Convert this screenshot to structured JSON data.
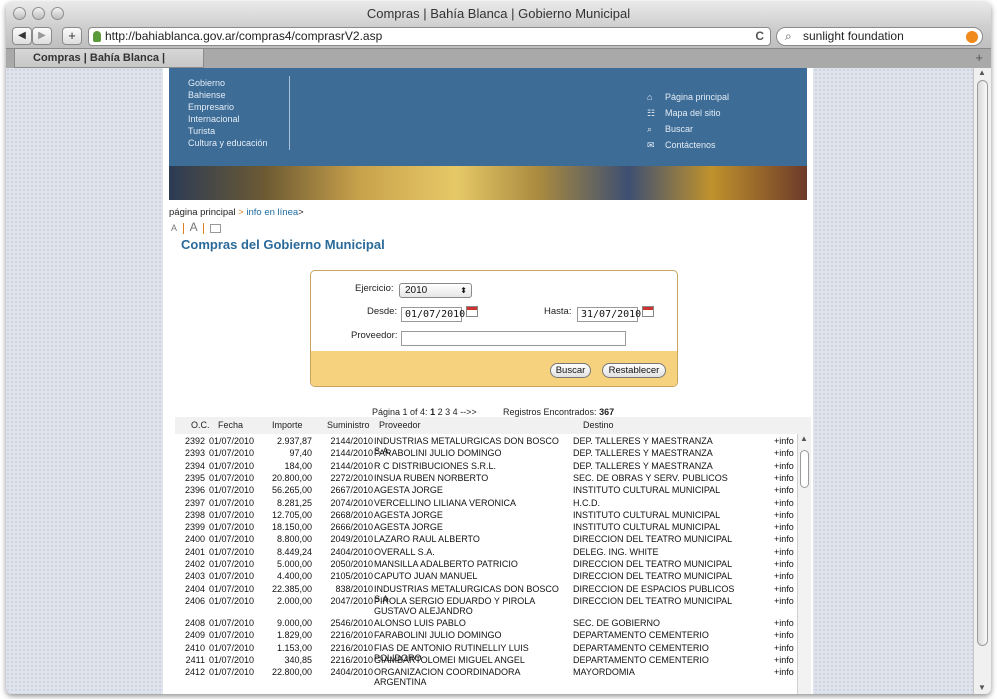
{
  "browser": {
    "title": "Compras | Bahía Blanca | Gobierno Municipal",
    "url": "http://bahiablanca.gov.ar/compras4/comprasrV2.asp",
    "search_text": "sunlight foundation",
    "tab_label": "Compras | Bahía Blanca | Gobiern...",
    "back": "◀",
    "forward": "▶",
    "add": "+",
    "reload": "C"
  },
  "banner": {
    "left_nav": [
      "Gobierno",
      "Bahiense",
      "Empresario",
      "Internacional",
      "Turista",
      "Cultura y educación"
    ],
    "right_nav": [
      {
        "icon": "home-icon",
        "glyph": "⌂",
        "label": "Página principal"
      },
      {
        "icon": "sitemap-icon",
        "glyph": "☷",
        "label": "Mapa del sitio"
      },
      {
        "icon": "search-icon",
        "glyph": "⌕",
        "label": "Buscar"
      },
      {
        "icon": "mail-icon",
        "glyph": "✉",
        "label": "Contáctenos"
      }
    ]
  },
  "breadcrumb": {
    "home": "página principal",
    "sep1": " > ",
    "info": "info en línea",
    "sep2": ">"
  },
  "font_controls": {
    "small": "A",
    "large": "A"
  },
  "page_title": "Compras del Gobierno Municipal",
  "form": {
    "ejercicio_label": "Ejercicio:",
    "ejercicio_value": "2010",
    "desde_label": "Desde:",
    "desde_value": "01/07/2010",
    "hasta_label": "Hasta:",
    "hasta_value": "31/07/2010",
    "proveedor_label": "Proveedor:",
    "proveedor_value": "",
    "buscar": "Buscar",
    "restablecer": "Restablecer"
  },
  "pager": {
    "prefix": "Página 1 of 4:",
    "current": "1",
    "pages": "2 3 4 -->>",
    "found_label": "Registros Encontrados:",
    "found_count": "367"
  },
  "table": {
    "headers": [
      "O.C.",
      "Fecha",
      "Importe",
      "Suministro",
      "Proveedor",
      "Destino"
    ],
    "rows": [
      {
        "oc": "2392",
        "fecha": "01/07/2010",
        "importe": "2.937,87",
        "suministro": "2144/2010",
        "proveedor": "INDUSTRIAS METALURGICAS DON BOSCO S.A.",
        "destino": "DEP. TALLERES Y MAESTRANZA",
        "info": "+info"
      },
      {
        "oc": "2393",
        "fecha": "01/07/2010",
        "importe": "97,40",
        "suministro": "2144/2010",
        "proveedor": "FARABOLINI JULIO DOMINGO",
        "destino": "DEP. TALLERES Y MAESTRANZA",
        "info": "+info"
      },
      {
        "oc": "2394",
        "fecha": "01/07/2010",
        "importe": "184,00",
        "suministro": "2144/2010",
        "proveedor": "R C DISTRIBUCIONES S.R.L.",
        "destino": "DEP. TALLERES Y MAESTRANZA",
        "info": "+info"
      },
      {
        "oc": "2395",
        "fecha": "01/07/2010",
        "importe": "20.800,00",
        "suministro": "2272/2010",
        "proveedor": "INSUA RUBEN NORBERTO",
        "destino": "SEC. DE OBRAS Y SERV. PUBLICOS",
        "info": "+info"
      },
      {
        "oc": "2396",
        "fecha": "01/07/2010",
        "importe": "56.265,00",
        "suministro": "2667/2010",
        "proveedor": "AGESTA JORGE",
        "destino": "INSTITUTO CULTURAL MUNICIPAL",
        "info": "+info"
      },
      {
        "oc": "2397",
        "fecha": "01/07/2010",
        "importe": "8.281,25",
        "suministro": "2074/2010",
        "proveedor": "VERCELLINO LILIANA VERONICA",
        "destino": "H.C.D.",
        "info": "+info"
      },
      {
        "oc": "2398",
        "fecha": "01/07/2010",
        "importe": "12.705,00",
        "suministro": "2668/2010",
        "proveedor": "AGESTA JORGE",
        "destino": "INSTITUTO CULTURAL MUNICIPAL",
        "info": "+info"
      },
      {
        "oc": "2399",
        "fecha": "01/07/2010",
        "importe": "18.150,00",
        "suministro": "2666/2010",
        "proveedor": "AGESTA JORGE",
        "destino": "INSTITUTO CULTURAL MUNICIPAL",
        "info": "+info"
      },
      {
        "oc": "2400",
        "fecha": "01/07/2010",
        "importe": "8.800,00",
        "suministro": "2049/2010",
        "proveedor": "LAZARO RAUL ALBERTO",
        "destino": "DIRECCION DEL TEATRO MUNICIPAL",
        "info": "+info"
      },
      {
        "oc": "2401",
        "fecha": "01/07/2010",
        "importe": "8.449,24",
        "suministro": "2404/2010",
        "proveedor": "OVERALL S.A.",
        "destino": "DELEG. ING. WHITE",
        "info": "+info"
      },
      {
        "oc": "2402",
        "fecha": "01/07/2010",
        "importe": "5.000,00",
        "suministro": "2050/2010",
        "proveedor": "MANSILLA ADALBERTO PATRICIO",
        "destino": "DIRECCION DEL TEATRO MUNICIPAL",
        "info": "+info"
      },
      {
        "oc": "2403",
        "fecha": "01/07/2010",
        "importe": "4.400,00",
        "suministro": "2105/2010",
        "proveedor": "CAPUTO JUAN MANUEL",
        "destino": "DIRECCION DEL TEATRO MUNICIPAL",
        "info": "+info"
      },
      {
        "oc": "2404",
        "fecha": "01/07/2010",
        "importe": "22.385,00",
        "suministro": "838/2010",
        "proveedor": "INDUSTRIAS METALURGICAS DON BOSCO S.A.",
        "destino": "DIRECCION DE ESPACIOS PUBLICOS",
        "info": "+info"
      },
      {
        "oc": "2406",
        "fecha": "01/07/2010",
        "importe": "2.000,00",
        "suministro": "2047/2010",
        "proveedor": "PIROLA SERGIO EDUARDO Y PIROLA GUSTAVO ALEJANDRO",
        "destino": "DIRECCION DEL TEATRO MUNICIPAL",
        "info": "+info"
      },
      {
        "oc": "2408",
        "fecha": "01/07/2010",
        "importe": "9.000,00",
        "suministro": "2546/2010",
        "proveedor": "ALONSO LUIS PABLO",
        "destino": "SEC. DE GOBIERNO",
        "info": "+info"
      },
      {
        "oc": "2409",
        "fecha": "01/07/2010",
        "importe": "1.829,00",
        "suministro": "2216/2010",
        "proveedor": "FARABOLINI JULIO DOMINGO",
        "destino": "DEPARTAMENTO CEMENTERIO",
        "info": "+info"
      },
      {
        "oc": "2410",
        "fecha": "01/07/2010",
        "importe": "1.153,00",
        "suministro": "2216/2010",
        "proveedor": "FIAS DE ANTONIO RUTINELLIY LUIS POLIDORO",
        "destino": "DEPARTAMENTO CEMENTERIO",
        "info": "+info"
      },
      {
        "oc": "2411",
        "fecha": "01/07/2010",
        "importe": "340,85",
        "suministro": "2216/2010",
        "proveedor": "GIAMBARTOLOMEI MIGUEL ANGEL",
        "destino": "DEPARTAMENTO CEMENTERIO",
        "info": "+info"
      },
      {
        "oc": "2412",
        "fecha": "01/07/2010",
        "importe": "22.800,00",
        "suministro": "2404/2010",
        "proveedor": "ORGANIZACION COORDINADORA ARGENTINA",
        "destino": "MAYORDOMIA",
        "info": "+info"
      }
    ]
  },
  "colors": {
    "banner": "#3d6c96",
    "accent_title": "#2a6a9a",
    "form_footer": "#f6d27f",
    "link": "#1c6aa0"
  }
}
